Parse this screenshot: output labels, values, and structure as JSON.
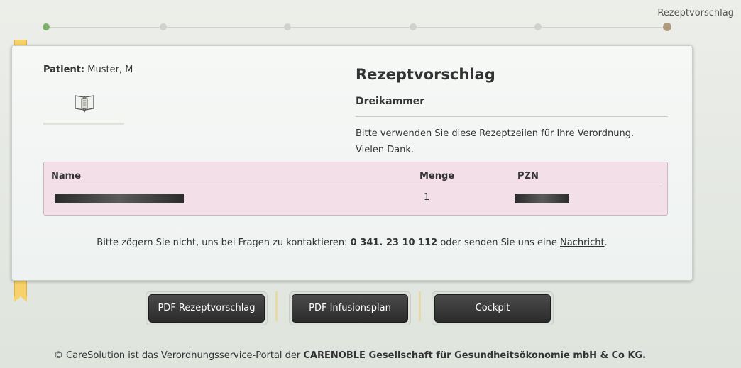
{
  "progress": {
    "current_step_label": "Rezeptvorschlag",
    "steps": 6
  },
  "patient": {
    "label": "Patient:",
    "value": "Muster, M"
  },
  "prescription": {
    "title": "Rezeptvorschlag",
    "subtitle": "Dreikammer",
    "notice_line1": "Bitte verwenden Sie diese Rezeptzeilen für Ihre Verordnung.",
    "notice_line2": "Vielen Dank."
  },
  "table": {
    "headers": [
      "Name",
      "Menge",
      "PZN"
    ],
    "rows": [
      {
        "name": "[redacted]",
        "menge": "1",
        "pzn": "[redacted]"
      }
    ]
  },
  "contact": {
    "text_before": "Bitte zögern Sie nicht, uns bei Fragen zu kontaktieren:",
    "phone": "0 341. 23 10 112",
    "text_middle": "oder senden Sie uns eine",
    "link": "Nachricht",
    "text_after": "."
  },
  "buttons": {
    "pdf_rezept": "PDF Rezeptvorschlag",
    "pdf_infusion": "PDF Infusionsplan",
    "cockpit": "Cockpit"
  },
  "footer": {
    "text": "© CareSolution ist das Verordnungsservice-Portal der",
    "company": "CARENOBLE Gesellschaft für Gesundheitsökonomie mbH & Co KG."
  },
  "colors": {
    "step_done": "#7fb06a",
    "step_current": "#b09a7e",
    "table_bg": "#f3dfe7",
    "bookmark": "#f7d26a",
    "button_bg": "#2f2f2f"
  },
  "icons": [
    "book-icon"
  ]
}
